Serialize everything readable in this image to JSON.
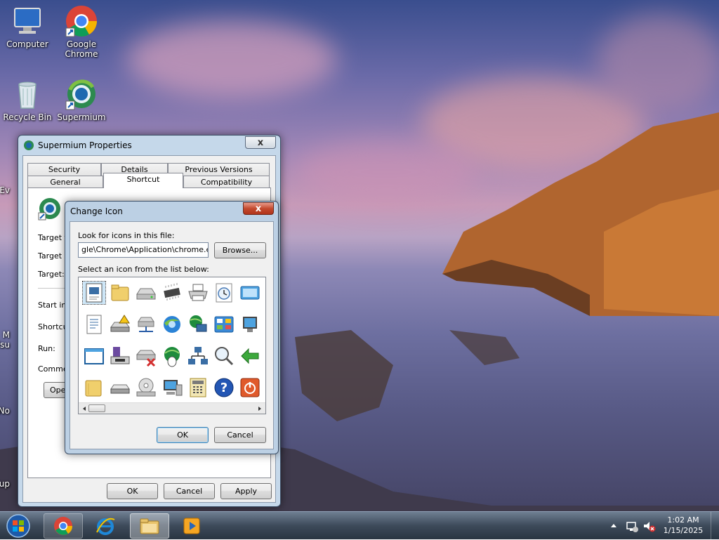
{
  "desktop": {
    "icons": [
      {
        "label": "Computer",
        "icon": "computer-icon"
      },
      {
        "label": "Google Chrome",
        "icon": "chrome-icon"
      },
      {
        "label": "Recycle Bin",
        "icon": "recycle-bin-icon"
      },
      {
        "label": "Supermium",
        "icon": "supermium-icon"
      }
    ],
    "partial_labels": [
      "Ev",
      "M",
      "Visu",
      "No",
      "Sup"
    ]
  },
  "properties_dialog": {
    "title": "Supermium Properties",
    "close_glyph": "x",
    "tabs_row1": [
      "Security",
      "Details",
      "Previous Versions"
    ],
    "tabs_row2": [
      "General",
      "Shortcut",
      "Compatibility"
    ],
    "active_tab": "Shortcut",
    "fields": {
      "target_type": "Target ty",
      "target_location": "Target lo",
      "target": "Target:",
      "start_in": "Start in:",
      "shortcut_key": "Shortcut",
      "run": "Run:",
      "comment": "Commen",
      "open_button": "Open"
    },
    "buttons": {
      "ok": "OK",
      "cancel": "Cancel",
      "apply": "Apply"
    }
  },
  "change_icon_dialog": {
    "title": "Change Icon",
    "close_glyph": "x",
    "look_for_label": "Look for icons in this file:",
    "file_path": "gle\\Chrome\\Application\\chrome.exe\"",
    "browse_button": "Browse...",
    "select_label": "Select an icon from the list below:",
    "icon_rows": [
      [
        "document-icon",
        "folder-icon",
        "drive-icon",
        "chip-icon",
        "printer-icon",
        "clock-icon",
        "window-icon"
      ],
      [
        "text-file-icon",
        "drive-warning-icon",
        "network-drive-icon",
        "internet-explorer-icon",
        "network-globe-icon",
        "control-panel-icon",
        "monitor-icon"
      ],
      [
        "window-frame-icon",
        "floppy-icon",
        "network-drive-error-icon",
        "globe-mouse-icon",
        "network-icon",
        "search-icon",
        "green-arrow-icon"
      ],
      [
        "folder-open-icon",
        "external-drive-icon",
        "cd-drive-icon",
        "computer-monitor-icon",
        "calculator-icon",
        "help-icon",
        "power-icon"
      ]
    ],
    "buttons": {
      "ok": "OK",
      "cancel": "Cancel"
    }
  },
  "taskbar": {
    "start": "start-orb-icon",
    "items": [
      "chrome-icon",
      "internet-explorer-icon",
      "file-explorer-icon",
      "media-player-icon"
    ],
    "clock_time": "1:02 AM",
    "clock_date": "1/15/2025"
  }
}
